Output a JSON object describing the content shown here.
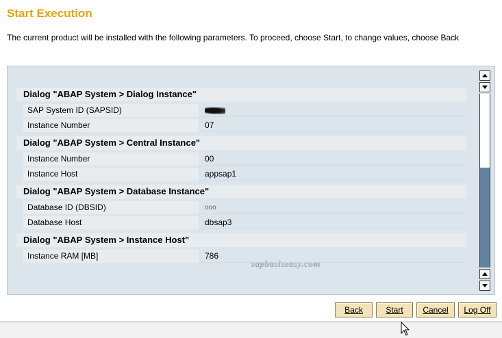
{
  "header": {
    "title": "Start Execution",
    "description": "The current product will be installed with the following parameters. To proceed, choose Start, to change values, choose Back"
  },
  "sections": [
    {
      "heading": "Dialog \"ABAP System > Dialog Instance\"",
      "rows": [
        {
          "label": "SAP System ID (SAPSID)",
          "value": ""
        },
        {
          "label": "Instance Number",
          "value": "07"
        }
      ]
    },
    {
      "heading": "Dialog \"ABAP System > Central Instance\"",
      "rows": [
        {
          "label": "Instance Number",
          "value": "00"
        },
        {
          "label": "Instance Host",
          "value": "appsap1"
        }
      ]
    },
    {
      "heading": "Dialog \"ABAP System > Database Instance\"",
      "rows": [
        {
          "label": "Database ID (DBSID)",
          "value": "ooo"
        },
        {
          "label": "Database Host",
          "value": "dbsap3"
        }
      ]
    },
    {
      "heading": "Dialog \"ABAP System > Instance Host\"",
      "rows": [
        {
          "label": "Instance RAM [MB]",
          "value": "786"
        }
      ]
    }
  ],
  "watermark": "sapbasiseasy.com",
  "buttons": {
    "back": "Back",
    "start": "Start",
    "cancel": "Cancel",
    "logoff": "Log Off"
  },
  "icons": {
    "scroll_up": "triangle-up-icon",
    "scroll_down": "triangle-down-icon",
    "cursor": "mouse-pointer-icon"
  },
  "colors": {
    "title": "#e8a200",
    "button_bg": "#f3e3b6",
    "scroll_thumb": "#62839e",
    "row_label_bg": "#e8ecef"
  }
}
